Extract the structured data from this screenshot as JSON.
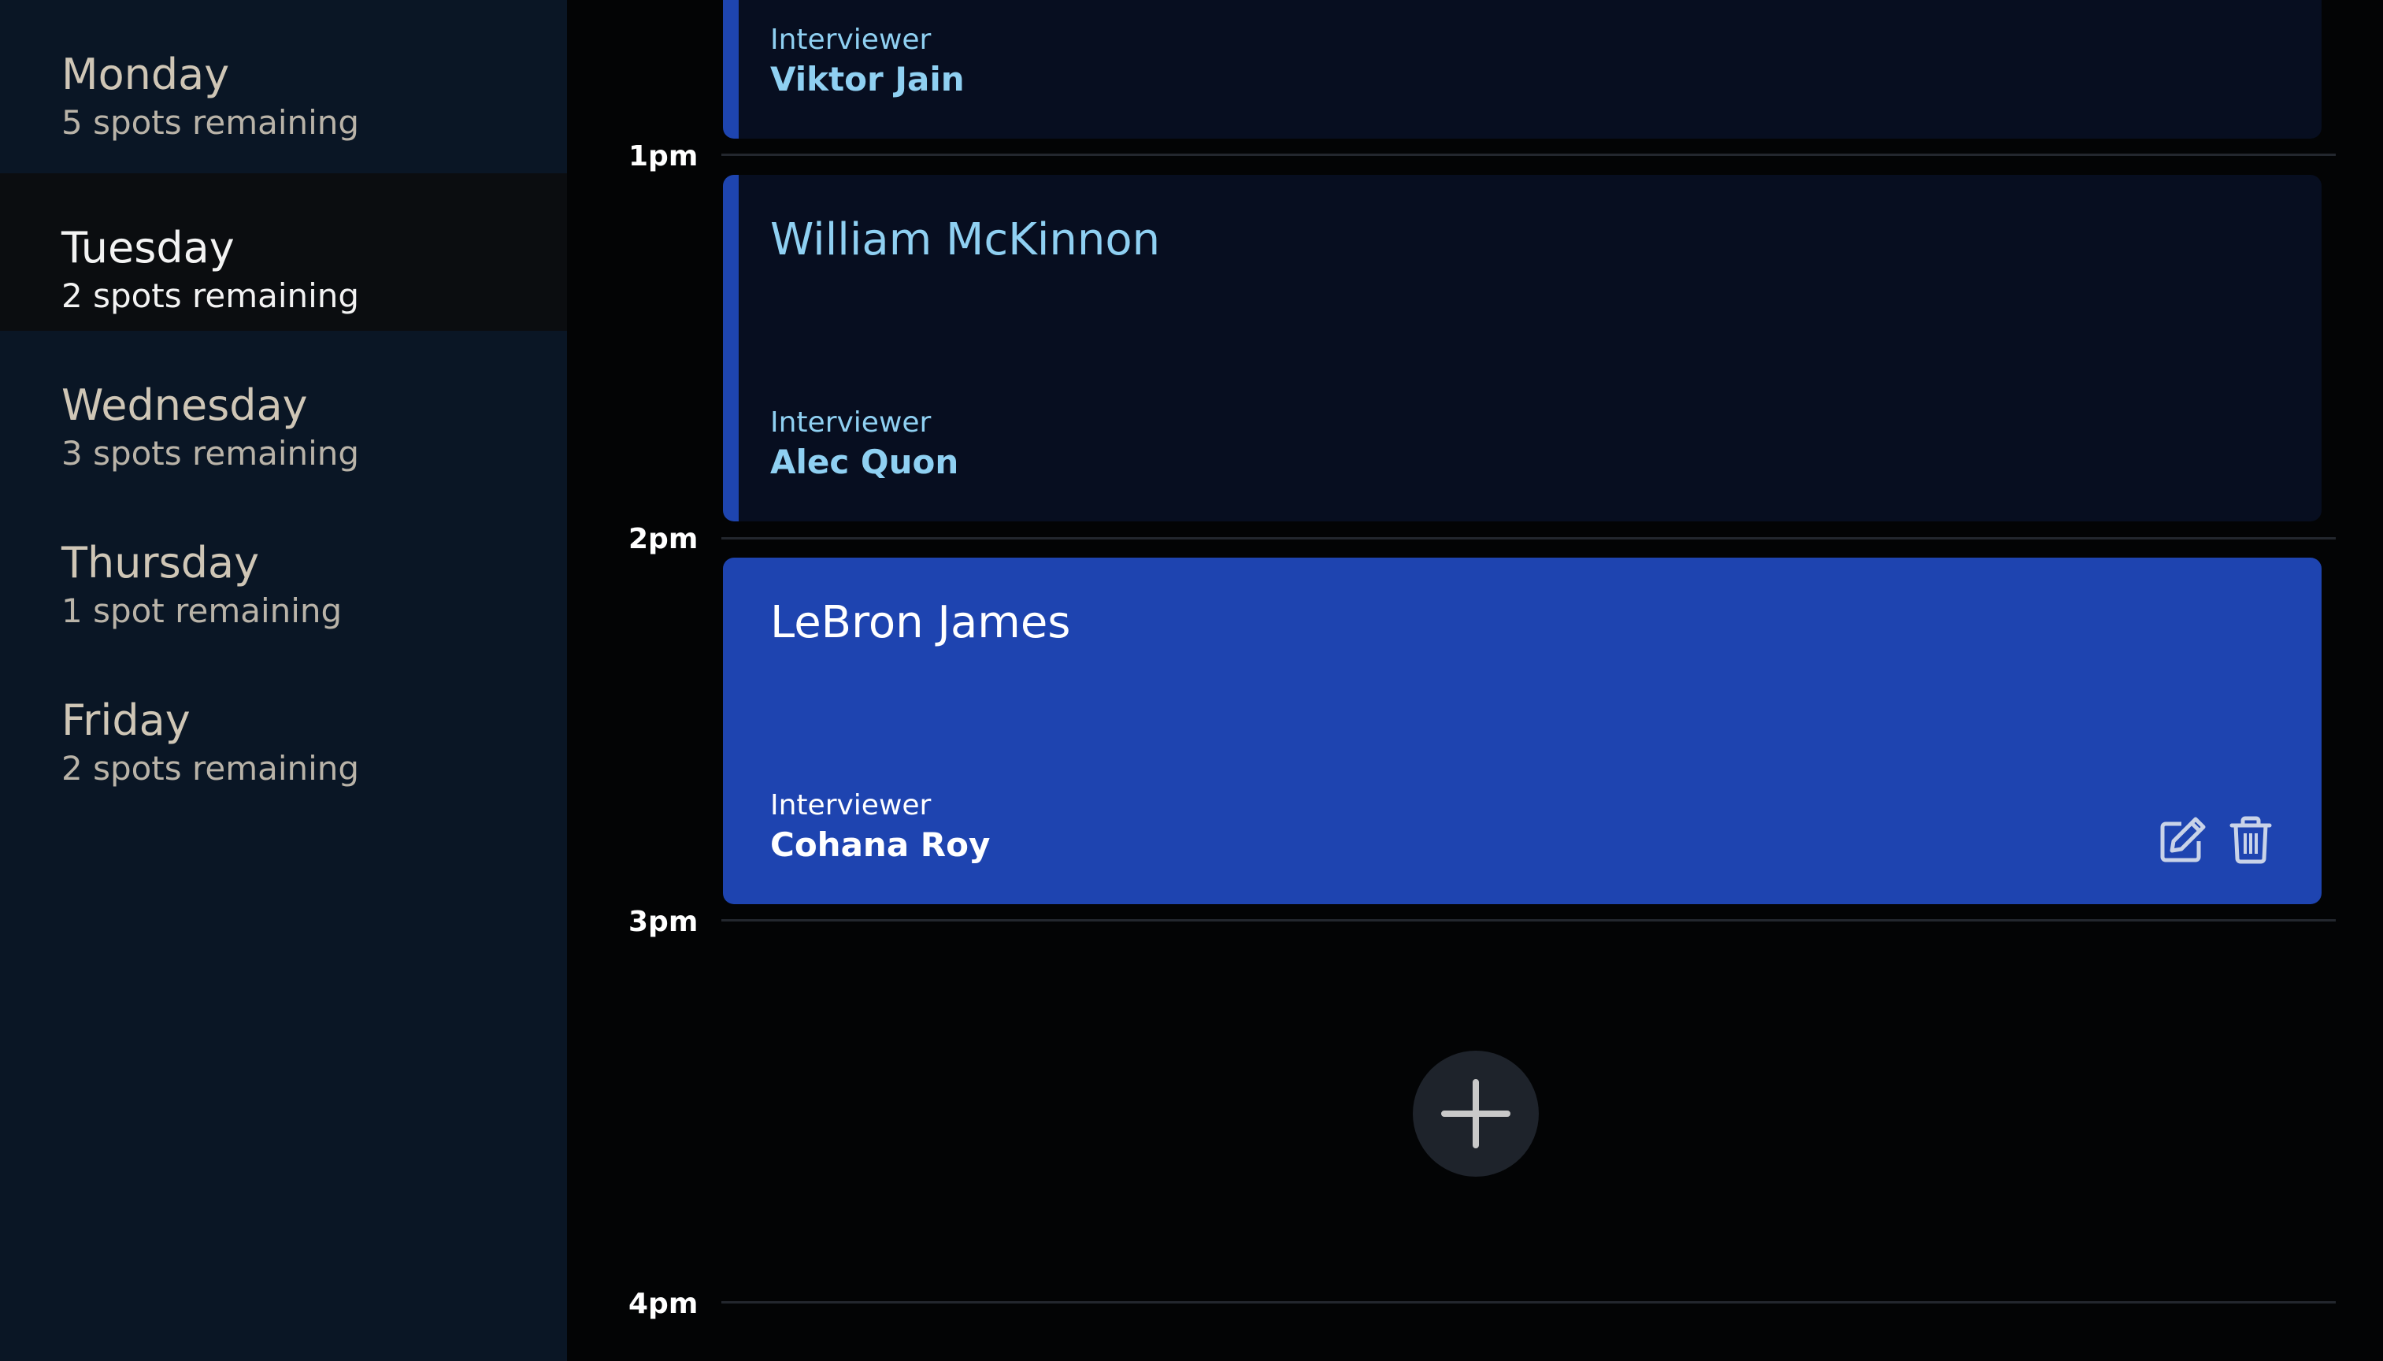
{
  "sidebar": {
    "days": [
      {
        "name": "Monday",
        "spots": "5 spots remaining",
        "selected": false
      },
      {
        "name": "Tuesday",
        "spots": "2 spots remaining",
        "selected": true
      },
      {
        "name": "Wednesday",
        "spots": "3 spots remaining",
        "selected": false
      },
      {
        "name": "Thursday",
        "spots": "1 spot remaining",
        "selected": false
      },
      {
        "name": "Friday",
        "spots": "2 spots remaining",
        "selected": false
      }
    ]
  },
  "schedule": {
    "time_labels": [
      "1pm",
      "2pm",
      "3pm",
      "4pm"
    ],
    "appointments": [
      {
        "student": "",
        "interviewer_label": "Interviewer",
        "interviewer": "Viktor Jain",
        "state": "past"
      },
      {
        "student": "William McKinnon",
        "interviewer_label": "Interviewer",
        "interviewer": "Alec Quon",
        "state": "past"
      },
      {
        "student": "LeBron James",
        "interviewer_label": "Interviewer",
        "interviewer": "Cohana Roy",
        "state": "active"
      }
    ],
    "actions": {
      "edit_icon": "edit-icon",
      "delete_icon": "trash-icon"
    },
    "add_icon": "plus-icon"
  },
  "colors": {
    "sidebar_bg": "#0a1625",
    "selected_day_bg": "#0b0d10",
    "accent_blue": "#1e44b0",
    "past_card_bg": "#070e20",
    "light_blue_text": "#8fd0f2"
  }
}
